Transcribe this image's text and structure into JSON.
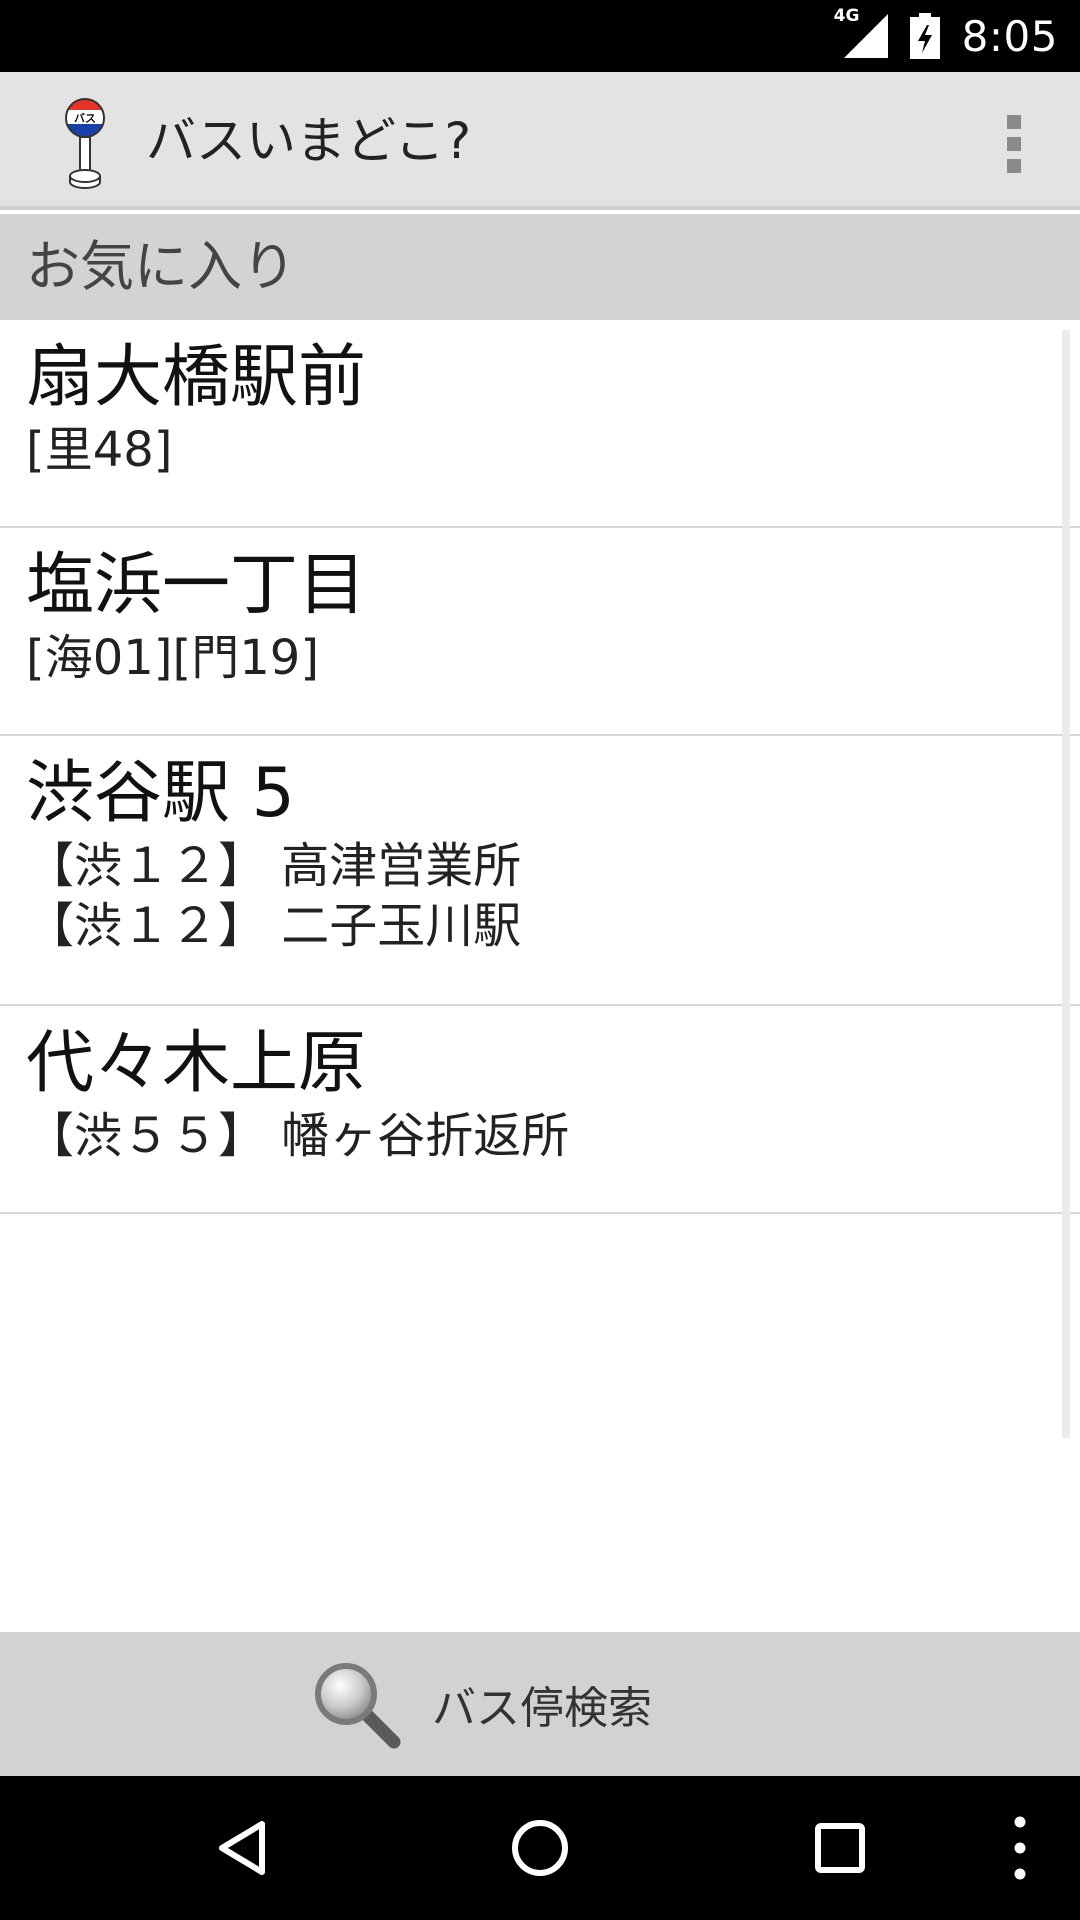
{
  "status_bar": {
    "network": "4G",
    "time": "8:05"
  },
  "app_bar": {
    "title": "バスいまどこ?",
    "icon": "bus-stop-sign-icon",
    "icon_text": "バス",
    "overflow_icon": "overflow-menu-icon"
  },
  "favorites": {
    "header": "お気に入り",
    "items": [
      {
        "name": "扇大橋駅前",
        "routes": [
          "[里48]"
        ]
      },
      {
        "name": "塩浜一丁目",
        "routes": [
          "[海01][門19]"
        ]
      },
      {
        "name": "渋谷駅 5",
        "routes": [
          "【渋１２】 高津営業所",
          "【渋１２】 二子玉川駅"
        ]
      },
      {
        "name": "代々木上原",
        "routes": [
          "【渋５５】 幡ヶ谷折返所"
        ]
      }
    ]
  },
  "search_bar": {
    "label": "バス停検索",
    "icon": "magnifier-icon"
  },
  "nav_bar": {
    "back_icon": "back-triangle-icon",
    "home_icon": "home-circle-icon",
    "recents_icon": "recents-square-icon",
    "menu_icon": "menu-dots-icon"
  },
  "colors": {
    "app_bar_bg": "#e3e3e3",
    "section_header_bg": "#d3d3d3",
    "search_bar_bg": "#d2d2d2",
    "divider": "#d8d8d8",
    "icon_red": "#e8332a",
    "icon_blue": "#1a3fa8"
  }
}
